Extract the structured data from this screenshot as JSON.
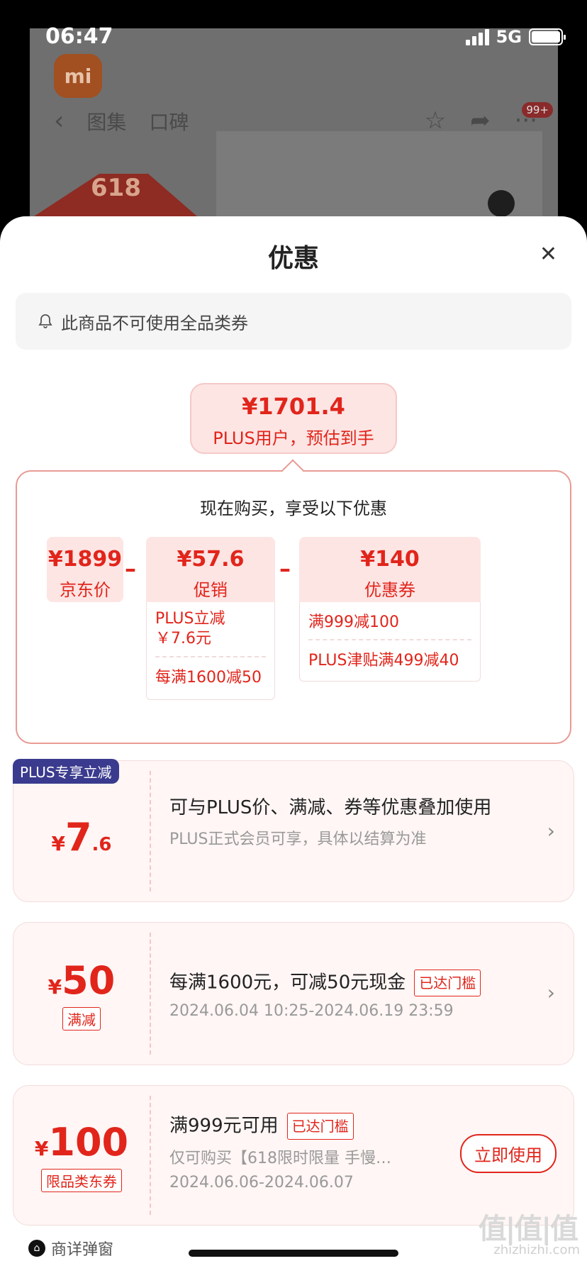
{
  "status_bar": {
    "time": "06:47",
    "network": "5G"
  },
  "background_app": {
    "logo": "mi",
    "tabs": [
      "图集",
      "口碑"
    ],
    "badge": "99+",
    "promo": "618"
  },
  "sheet": {
    "title": "优惠",
    "notice": "此商品不可使用全品类券",
    "estimate": {
      "price": "¥1701.4",
      "label": "PLUS用户，预估到手"
    },
    "calc": {
      "title": "现在购买，享受以下优惠",
      "jd_price": {
        "value": "¥1899",
        "label": "京东价"
      },
      "promo": {
        "value": "¥57.6",
        "label": "促销",
        "details": [
          "PLUS立减\n￥7.6元",
          "每满1600减50"
        ]
      },
      "coupon": {
        "value": "¥140",
        "label": "优惠券",
        "details": [
          "满999减100",
          "PLUS津贴满499减40"
        ]
      }
    },
    "offers": [
      {
        "badge": "PLUS专享立减",
        "yen": "¥",
        "amount_big": "7",
        "amount_small": ".6",
        "title": "可与PLUS价、满减、券等优惠叠加使用",
        "subtitle": "PLUS正式会员可享，具体以结算为准"
      },
      {
        "yen": "¥",
        "amount_big": "50",
        "tag": "满减",
        "title": "每满1600元，可减50元现金",
        "reach": "已达门槛",
        "subtitle": "2024.06.04 10:25-2024.06.19 23:59"
      },
      {
        "yen": "¥",
        "amount_big": "100",
        "tag": "限品类东券",
        "title": "满999元可用",
        "reach": "已达门槛",
        "desc": "仅可购买【618限时限量 手慢…",
        "subtitle": "2024.06.06-2024.06.07",
        "button": "立即使用"
      }
    ],
    "footer": "商详弹窗",
    "watermark": "值|值|值",
    "watermark_url": "zhizhizhi.com"
  },
  "colors": {
    "accent": "#e1251b",
    "pink_bg": "#fde5e4",
    "plus_badge": "#3a3a8e"
  }
}
